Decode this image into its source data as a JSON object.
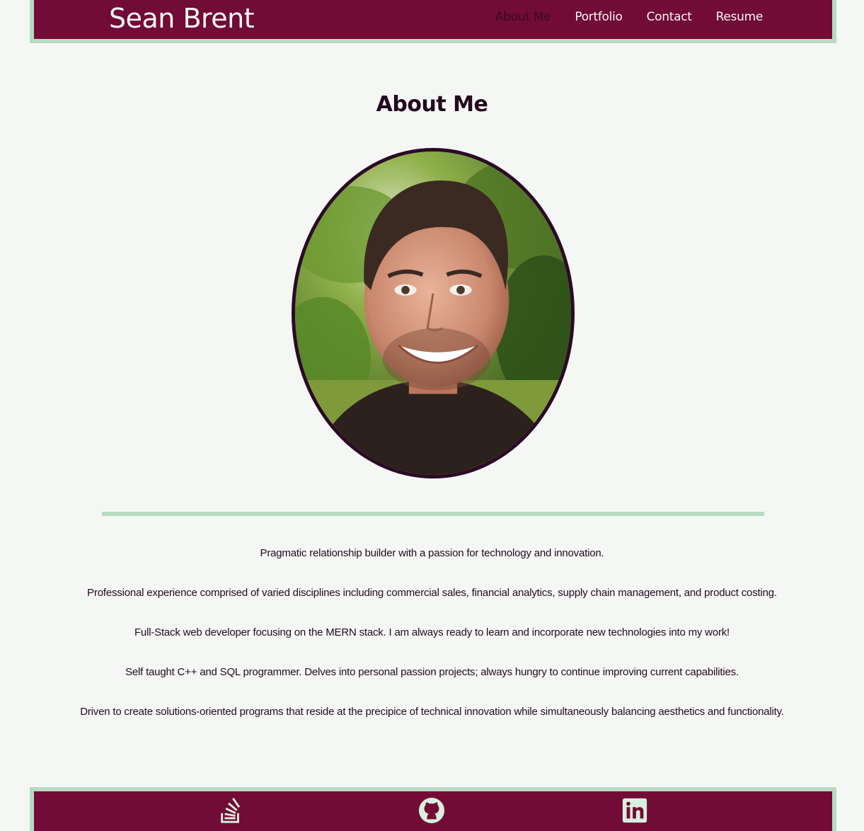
{
  "header": {
    "brand": "Sean Brent",
    "nav": [
      {
        "label": "About Me",
        "active": true
      },
      {
        "label": "Portfolio",
        "active": false
      },
      {
        "label": "Contact",
        "active": false
      },
      {
        "label": "Resume",
        "active": false
      }
    ]
  },
  "main": {
    "title": "About Me",
    "bio": [
      "Pragmatic relationship builder with a passion for technology and innovation.",
      "Professional experience comprised of varied disciplines including commercial sales, financial analytics, supply chain management, and product costing.",
      "Full-Stack web developer focusing on the MERN stack. I am always ready to learn and incorporate new technologies into my work!",
      "Self taught C++ and SQL programmer. Delves into personal passion projects; always hungry to continue improving current capabilities.",
      "Driven to create solutions-oriented programs that reside at the precipice of technical innovation while simultaneously balancing aesthetics and functionality."
    ]
  },
  "footer": {
    "icons": [
      "stack-overflow-icon",
      "github-icon",
      "linkedin-icon"
    ]
  },
  "colors": {
    "header_bg": "#720b35",
    "accent_border": "#b6dbc1",
    "page_bg": "#f5f7f5",
    "text": "#23091f",
    "portrait_border": "#2b0a27"
  }
}
